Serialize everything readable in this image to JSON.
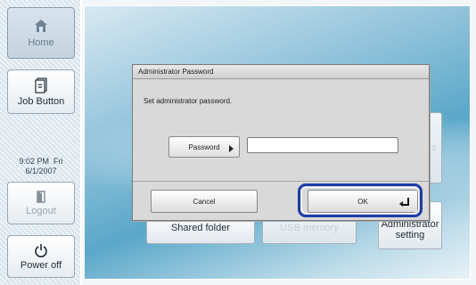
{
  "sidebar": {
    "home_label": "Home",
    "job_button_label": "Job Button",
    "clock_time": "9:02 PM  Fri",
    "clock_date": "6/1/2007",
    "logout_label": "Logout",
    "power_off_label": "Power off"
  },
  "background_buttons": {
    "shared_folder": "Shared folder",
    "usb_memory": "USB memory",
    "administrator_setting": "Administrator setting",
    "partial_right_text": "s"
  },
  "dialog": {
    "title": "Administrator Password",
    "message": "Set administrator password.",
    "password_label": "Password",
    "password_value": "",
    "cancel_label": "Cancel",
    "ok_label": "OK"
  },
  "colors": {
    "focus_ring": "#1d3ea8",
    "dialog_bg": "#d9d9d9"
  }
}
